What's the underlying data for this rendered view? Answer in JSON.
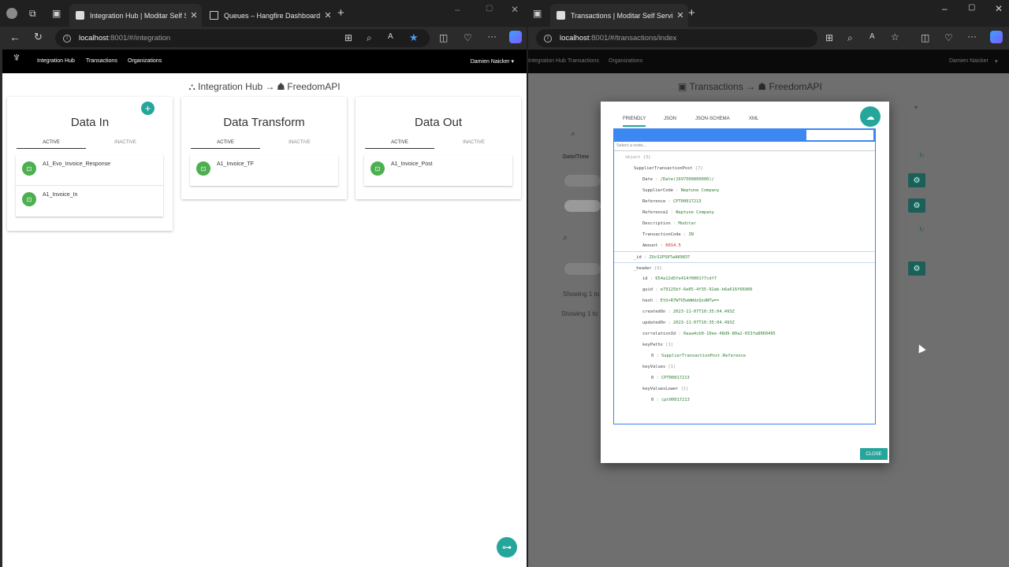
{
  "left_window": {
    "tabs": [
      {
        "title": "Integration Hub | Moditar Self Se"
      },
      {
        "title": "Queues – Hangfire Dashboard"
      }
    ],
    "url_host": "localhost",
    "url_rest": ":8001/#/integration",
    "nav": {
      "items": [
        "Integration Hub",
        "Transactions",
        "Organizations"
      ],
      "user": "Damien Naicker"
    },
    "breadcrumb": {
      "section": "Integration Hub",
      "arrow": "→",
      "target": "FreedomAPI"
    },
    "cards": [
      {
        "title": "Data In",
        "active_label": "ACTIVE",
        "inactive_label": "INACTIVE",
        "items": [
          "A1_Evo_Invoice_Response",
          "A1_Invoice_In"
        ]
      },
      {
        "title": "Data Transform",
        "active_label": "ACTIVE",
        "inactive_label": "INACTIVE",
        "items": [
          "A1_Invoice_TF"
        ]
      },
      {
        "title": "Data Out",
        "active_label": "ACTIVE",
        "inactive_label": "INACTIVE",
        "items": [
          "A1_Invoice_Post"
        ]
      }
    ]
  },
  "right_window": {
    "tab_title": "Transactions | Moditar Self Servic",
    "url_host": "localhost",
    "url_rest": ":8001/#/transactions/index",
    "nav": {
      "items": [
        "Integration Hub",
        "Transactions",
        "Organizations"
      ],
      "user": "Damien Naicker"
    },
    "breadcrumb": {
      "section": "Transactions",
      "arrow": "→",
      "target": "FreedomAPI"
    },
    "background": {
      "date_header": "Date/Time",
      "showing_1": "Showing 1 to",
      "showing_2": "Showing 1 to"
    },
    "modal": {
      "tabs": [
        "FRIENDLY",
        "JSON",
        "JSON-SCHEMA",
        "XML"
      ],
      "select_node": "Select a node...",
      "close_label": "CLOSE",
      "tree": [
        {
          "indent": 0,
          "key": "object",
          "value": "{3}",
          "kind": "count"
        },
        {
          "indent": 1,
          "key": "SupplierTransactionPost",
          "value": "{7}",
          "kind": "count"
        },
        {
          "indent": 2,
          "key": "Date",
          "value": "/Date(1697500800000)/",
          "kind": "str"
        },
        {
          "indent": 2,
          "key": "SupplierCode",
          "value": "Neptune Company",
          "kind": "str"
        },
        {
          "indent": 2,
          "key": "Reference",
          "value": "CPT00017213",
          "kind": "str"
        },
        {
          "indent": 2,
          "key": "Reference2",
          "value": "Neptune Company",
          "kind": "str"
        },
        {
          "indent": 2,
          "key": "Description",
          "value": "Moditar",
          "kind": "str"
        },
        {
          "indent": 2,
          "key": "TransactionCode",
          "value": "IN",
          "kind": "str"
        },
        {
          "indent": 2,
          "key": "Amount",
          "value": "6014.5",
          "kind": "num"
        },
        {
          "indent": 1,
          "key": "_id",
          "value": "ZUcS2PS0TwA89837",
          "kind": "str",
          "group": true
        },
        {
          "indent": 1,
          "key": "_header",
          "value": "{9}",
          "kind": "count",
          "group": true
        },
        {
          "indent": 2,
          "key": "id",
          "value": "654a12d5fe414f0001f7cdf7",
          "kind": "str"
        },
        {
          "indent": 2,
          "key": "guid",
          "value": "e79125bf-6e05-4f35-92ab-b6a616f66906",
          "kind": "str"
        },
        {
          "indent": 2,
          "key": "hash",
          "value": "EtU+R7W7U5eWWdzQzdWTw==",
          "kind": "str"
        },
        {
          "indent": 2,
          "key": "createdOn",
          "value": "2023-11-07T10:35:04.493Z",
          "kind": "str"
        },
        {
          "indent": 2,
          "key": "updatedOn",
          "value": "2023-11-07T10:35:04.493Z",
          "kind": "str"
        },
        {
          "indent": 2,
          "key": "correlationId",
          "value": "0aaa4cb0-10ee-48d9-80a2-653fa8060495",
          "kind": "str"
        },
        {
          "indent": 2,
          "key": "keyPaths",
          "value": "[1]",
          "kind": "count"
        },
        {
          "indent": 3,
          "key": "0",
          "value": "SupplierTransactionPost.Reference",
          "kind": "str"
        },
        {
          "indent": 2,
          "key": "keyValues",
          "value": "[1]",
          "kind": "count"
        },
        {
          "indent": 3,
          "key": "0",
          "value": "CPT00017213",
          "kind": "str"
        },
        {
          "indent": 2,
          "key": "keyValuesLower",
          "value": "[1]",
          "kind": "count"
        },
        {
          "indent": 3,
          "key": "0",
          "value": "cpt00017213",
          "kind": "str"
        }
      ]
    }
  },
  "colors": {
    "teal": "#26a69a",
    "green": "#4caf50",
    "tree_blue": "#3c87f0"
  }
}
